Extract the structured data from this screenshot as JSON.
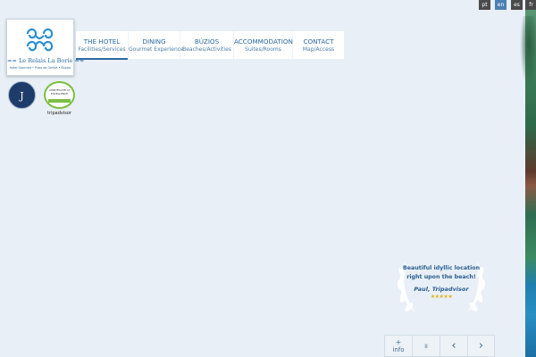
{
  "languages": [
    {
      "code": "pt",
      "active": false
    },
    {
      "code": "en",
      "active": true
    },
    {
      "code": "es",
      "active": false
    },
    {
      "code": "fr",
      "active": false
    }
  ],
  "logo": {
    "name": "Le Relais La Borie",
    "tagline": "Hotel Gourmet • Praia do Geribá • Búzios"
  },
  "badges": {
    "jacquin_letter": "J",
    "tripadvisor_cert": "CERTIFICATE of EXCELLENCE",
    "tripadvisor_brand": "tripadvisor"
  },
  "nav": [
    {
      "label": "THE HOTEL",
      "sub": "Facilities/Services",
      "active": true
    },
    {
      "label": "DINING",
      "sub": "Gourmet Experience",
      "active": false
    },
    {
      "label": "BÚZIOS",
      "sub": "Beaches/Activities",
      "active": false
    },
    {
      "label": "ACCOMMODATION",
      "sub": "Suites/Rooms",
      "active": false
    },
    {
      "label": "CONTACT",
      "sub": "Map/Access",
      "active": false
    }
  ],
  "review": {
    "quote_line1": "Beautiful idyllic location",
    "quote_line2": "right upon the beach!",
    "author": "Paul, Tripadvisor",
    "stars": "★★★★★"
  },
  "controls": {
    "info_plus": "+",
    "info_label": "info",
    "pause": "II",
    "prev": "‹",
    "next": "›"
  },
  "colors": {
    "background": "#e8eff6",
    "brand_blue": "#2b6aa0",
    "lang_active": "#4c7fb3",
    "lang_inactive": "#4a4a4a",
    "star": "#e3b21a"
  }
}
